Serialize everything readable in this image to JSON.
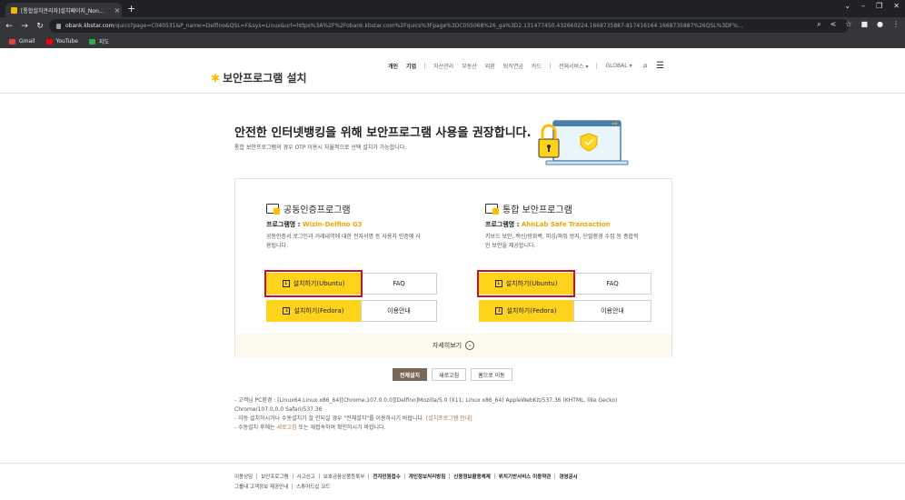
{
  "browser": {
    "tab_title": "[통합설치관리자]설치페이지_Non...",
    "tab_close": "×",
    "new_tab": "+",
    "url_host": "obank.kbstar.com",
    "url_rest": "/quics?page=C040531&P_name=Delfino&QSL=F&sys=Linux&url=https%3A%2F%2Fobank.kbstar.com%2Fquics%3Fpage%3DC055068%26_ga%3D2.131477450.432660224.1668735887-817416164.1668735887%26QSL%3DF%...",
    "bookmarks": [
      {
        "label": "Gmail",
        "color": "#ea4335"
      },
      {
        "label": "YouTube",
        "color": "#ff0000"
      },
      {
        "label": "지도",
        "color": "#34a853"
      }
    ]
  },
  "header": {
    "logo_mark": "✱",
    "logo_text": "보안프로그램 설치",
    "nav": [
      "개인",
      "기업",
      "자산관리",
      "부동산",
      "외환",
      "퇴직연금",
      "카드",
      "전체서비스 ▾",
      "GLOBAL ▾"
    ],
    "search_icon": "⌕",
    "menu_icon": "☰"
  },
  "hero": {
    "title": "안전한 인터넷뱅킹을 위해 보안프로그램 사용을 권장합니다.",
    "subtitle": "통합 보안프로그램의 경우 OTP 이용시 자율적으로 선택 설치가 가능합니다."
  },
  "cards": [
    {
      "title": "공동인증프로그램",
      "program_label": "프로그램명 : ",
      "program_name": "WizIn-Delfino G3",
      "desc": "공동인증서 로그인과 거래내역에 대한 전자서명 등 사용자 인증에 사용됩니다.",
      "install_ubuntu": "설치하기(Ubuntu)",
      "install_fedora": "설치하기(Fedora)",
      "faq": "FAQ",
      "guide": "이용안내"
    },
    {
      "title": "통합 보안프로그램",
      "program_label": "프로그램명 : ",
      "program_name": "AhnLab Safe Transaction",
      "desc": "키보드 보안, 백신/방화벽, 피싱/파밍 방지, 단말환경 수집 등 종합적인 보안을 제공합니다.",
      "install_ubuntu": "설치하기(Ubuntu)",
      "install_fedora": "설치하기(Fedora)",
      "faq": "FAQ",
      "guide": "이용안내"
    }
  ],
  "more": {
    "label": "자세히보기",
    "icon": "⌄"
  },
  "actions": {
    "install_all": "전체설치",
    "refresh": "새로고침",
    "home": "홈으로 이동"
  },
  "notes": {
    "line1": "- 고객님 PC환경 : [Linux64,Linux x86_64][Chrome,107.0.0.0][Delfino]Mozilla/5.0 (X11; Linux x86_64) AppleWebKit/537.36 (KHTML, like Gecko) Chrome/107.0.0.0 Safari/537.36",
    "line2_a": "- 자동 설치하시거나 수동설치가 잘 안되실 경우 \"전체설치\"를 이용하시기 바랍니다. ",
    "line2_link": "[설치프로그램 안내]",
    "line3_a": "- 수동설치 후에는 ",
    "line3_link": "새로고침",
    "line3_b": " 또는 재접속하여 확인하시기 바랍니다."
  },
  "footer": {
    "row1": [
      "이용상담",
      "보안프로그램",
      "사고신고",
      "보호금융상품등록부",
      "전자민원접수",
      "개인정보처리방침",
      "신용정보활용체제",
      "위치기반서비스 이용약관",
      "경영공시"
    ],
    "row2": [
      "그룹내 고객정보 제공안내",
      "스튜어드십 코드"
    ]
  }
}
